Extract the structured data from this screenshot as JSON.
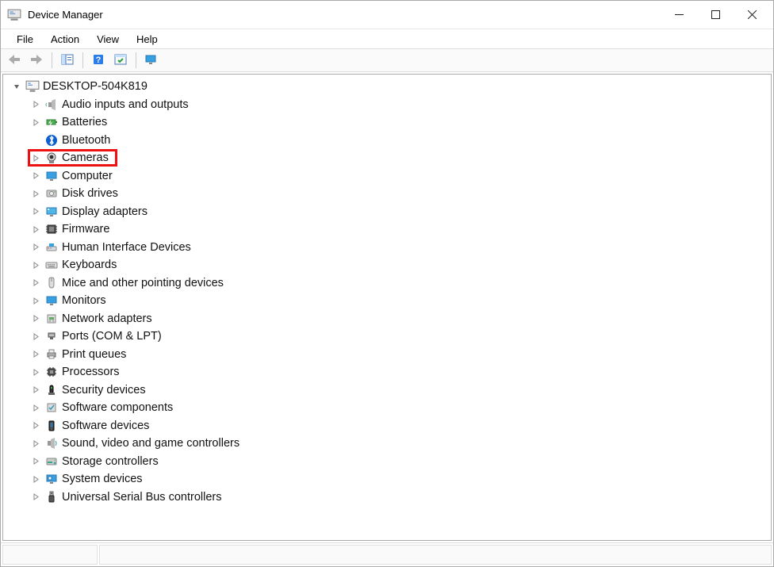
{
  "window": {
    "title": "Device Manager"
  },
  "menu": {
    "file": "File",
    "action": "Action",
    "view": "View",
    "help": "Help"
  },
  "toolbar": {
    "back": "back",
    "forward": "forward",
    "show_hide": "show-hide",
    "help": "help",
    "scan": "scan-for-hardware",
    "devices": "devices-monitor"
  },
  "tree": {
    "root": {
      "label": "DESKTOP-504K819",
      "icon": "computer-root-icon",
      "expanded": true
    },
    "categories": [
      {
        "icon": "audio-icon",
        "label": "Audio inputs and outputs",
        "highlighted": false
      },
      {
        "icon": "battery-icon",
        "label": "Batteries",
        "highlighted": false
      },
      {
        "icon": "bluetooth-icon",
        "label": "Bluetooth",
        "highlighted": false,
        "no_expander": true
      },
      {
        "icon": "camera-icon",
        "label": "Cameras",
        "highlighted": true
      },
      {
        "icon": "monitor-icon",
        "label": "Computer",
        "highlighted": false
      },
      {
        "icon": "disk-icon",
        "label": "Disk drives",
        "highlighted": false
      },
      {
        "icon": "display-icon",
        "label": "Display adapters",
        "highlighted": false
      },
      {
        "icon": "firmware-icon",
        "label": "Firmware",
        "highlighted": false
      },
      {
        "icon": "hid-icon",
        "label": "Human Interface Devices",
        "highlighted": false
      },
      {
        "icon": "keyboard-icon",
        "label": "Keyboards",
        "highlighted": false
      },
      {
        "icon": "mouse-icon",
        "label": "Mice and other pointing devices",
        "highlighted": false
      },
      {
        "icon": "monitor2-icon",
        "label": "Monitors",
        "highlighted": false
      },
      {
        "icon": "network-icon",
        "label": "Network adapters",
        "highlighted": false
      },
      {
        "icon": "ports-icon",
        "label": "Ports (COM & LPT)",
        "highlighted": false
      },
      {
        "icon": "printer-icon",
        "label": "Print queues",
        "highlighted": false
      },
      {
        "icon": "cpu-icon",
        "label": "Processors",
        "highlighted": false
      },
      {
        "icon": "security-icon",
        "label": "Security devices",
        "highlighted": false
      },
      {
        "icon": "swcomp-icon",
        "label": "Software components",
        "highlighted": false
      },
      {
        "icon": "swdev-icon",
        "label": "Software devices",
        "highlighted": false
      },
      {
        "icon": "sound-icon",
        "label": "Sound, video and game controllers",
        "highlighted": false
      },
      {
        "icon": "storage-icon",
        "label": "Storage controllers",
        "highlighted": false
      },
      {
        "icon": "system-icon",
        "label": "System devices",
        "highlighted": false
      },
      {
        "icon": "usb-icon",
        "label": "Universal Serial Bus controllers",
        "highlighted": false
      }
    ]
  }
}
